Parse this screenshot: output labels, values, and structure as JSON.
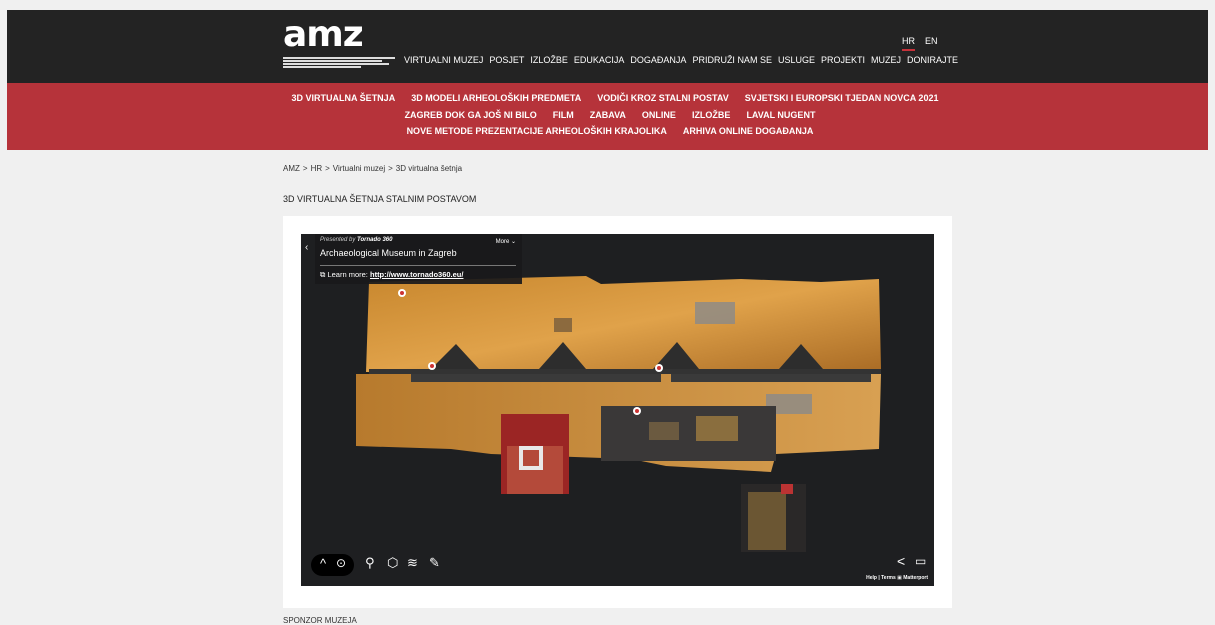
{
  "logo": {
    "text": "amz"
  },
  "main_nav": [
    "VIRTUALNI MUZEJ",
    "POSJET",
    "IZLOŽBE",
    "EDUKACIJA",
    "DOGAĐANJA",
    "PRIDRUŽI NAM SE",
    "USLUGE",
    "PROJEKTI",
    "MUZEJ",
    "DONIRAJTE"
  ],
  "lang": {
    "hr": "HR",
    "en": "EN"
  },
  "subnav": {
    "row1": [
      "3D VIRTUALNA ŠETNJA",
      "3D MODELI ARHEOLOŠKIH PREDMETA",
      "VODIČI KROZ STALNI POSTAV",
      "SVJETSKI I EUROPSKI TJEDAN NOVCA 2021"
    ],
    "row2": [
      "ZAGREB DOK GA JOŠ NI BILO",
      "FILM",
      "ZABAVA",
      "ONLINE",
      "IZLOŽBE",
      "LAVAL NUGENT"
    ],
    "row3": [
      "NOVE METODE PREZENTACIJE ARHEOLOŠKIH KRAJOLIKA",
      "ARHIVA ONLINE DOGAĐANJA"
    ]
  },
  "breadcrumb": [
    "AMZ",
    ">",
    "HR",
    ">",
    "Virtualni muzej",
    ">",
    "3D virtualna šetnja"
  ],
  "page_title": "3D VIRTUALNA ŠETNJA STALNIM POSTAVOM",
  "viewer": {
    "presented_by": "Presented by",
    "presenter": "Tornado 360",
    "more": "More",
    "name": "Archaeological Museum in Zagreb",
    "learn_more": "Learn more:",
    "url": "http://www.tornado360.eu/",
    "credits": {
      "help": "Help",
      "sep": "|",
      "terms": "Terms",
      "brand": "Matterport"
    }
  },
  "footer_label": "SPONZOR MUZEJA",
  "colors": {
    "header": "#232323",
    "red": "#b6333a",
    "viewer_bg": "#1e1f21"
  }
}
